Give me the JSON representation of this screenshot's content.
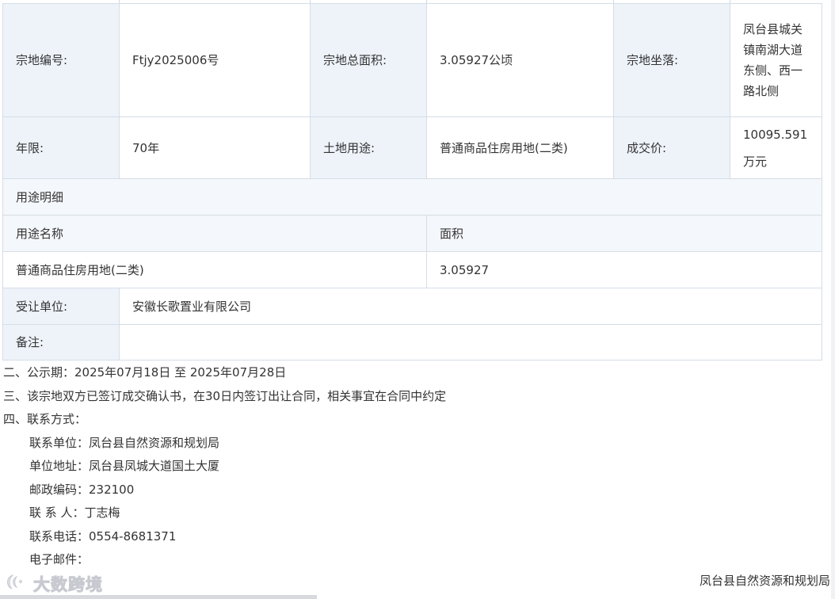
{
  "table": {
    "row1": {
      "parcel_no_label": "宗地编号:",
      "parcel_no_value": "Ftjy2025006号",
      "area_label": "宗地总面积:",
      "area_value": "3.05927公顷",
      "location_label": "宗地坐落:",
      "location_value": "凤台县城关镇南湖大道东侧、西一路北侧"
    },
    "row2": {
      "term_label": "年限:",
      "term_value": "70年",
      "use_label": "土地用途:",
      "use_value": "普通商品住房用地(二类)",
      "price_label": "成交价:",
      "price_value": "10095.591万元"
    },
    "use_detail_title": "用途明细",
    "use_detail_headers": [
      "用途名称",
      "面积"
    ],
    "use_detail_rows": [
      {
        "name": "普通商品住房用地(二类)",
        "area": "3.05927"
      }
    ],
    "grantee_label": "受让单位:",
    "grantee_value": "安徽长歌置业有限公司",
    "remark_label": "备注:",
    "remark_value": ""
  },
  "notes": {
    "period": "二、公示期：2025年07月18日 至 2025年07月28日",
    "contract": "三、该宗地双方已签订成交确认书，在30日内签订出让合同，相关事宜在合同中约定",
    "contact_title": "四、联系方式：",
    "contact_unit": "联系单位：凤台县自然资源和规划局",
    "contact_address": "单位地址：凤台县凤城大道国土大厦",
    "contact_postcode": "邮政编码：232100",
    "contact_person": "联 系 人：丁志梅",
    "contact_phone": "联系电话：0554-8681371",
    "contact_email": "电子邮件："
  },
  "footer": {
    "org": "凤台县自然资源和规划局"
  },
  "watermark": {
    "text": "大数跨境",
    "icon": "logo-icon"
  }
}
